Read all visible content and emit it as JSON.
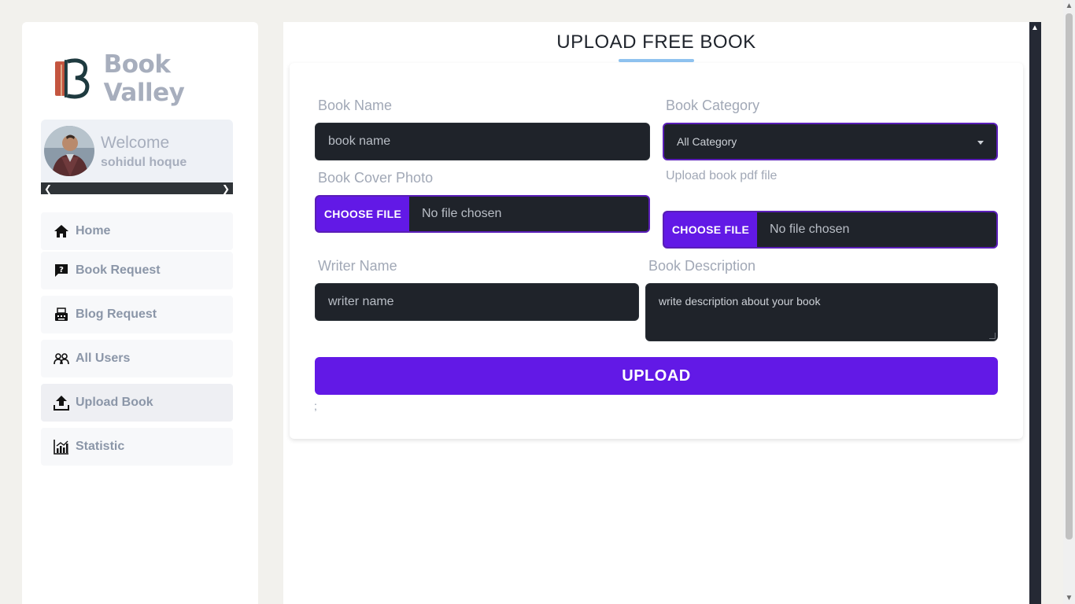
{
  "brand": {
    "name": "Book Valley",
    "logo_letter": "B"
  },
  "profile": {
    "greeting": "Welcome",
    "username": "sohidul hoque"
  },
  "sidebar": {
    "items": [
      {
        "label": "Home",
        "icon": "home-icon"
      },
      {
        "label": "Book Request",
        "icon": "question-chat-icon"
      },
      {
        "label": "Blog Request",
        "icon": "typewriter-icon"
      },
      {
        "label": "All Users",
        "icon": "users-icon"
      },
      {
        "label": "Upload Book",
        "icon": "upload-icon",
        "active": true
      },
      {
        "label": "Statistic",
        "icon": "chart-icon"
      }
    ]
  },
  "page": {
    "title": "UPLOAD FREE BOOK"
  },
  "form": {
    "book_name": {
      "label": "Book Name",
      "placeholder": "book name"
    },
    "book_category": {
      "label": "Book Category",
      "selected": "All Category"
    },
    "cover_photo": {
      "label": "Book Cover Photo",
      "button": "CHOOSE FILE",
      "status": "No file chosen"
    },
    "pdf_file": {
      "label": "Upload book pdf file",
      "button": "CHOOSE FILE",
      "status": "No file chosen"
    },
    "writer_name": {
      "label": "Writer Name",
      "placeholder": "writer name"
    },
    "description": {
      "label": "Book Description",
      "placeholder": "write description about your book"
    },
    "submit": "UPLOAD",
    "trailing_text": ";"
  },
  "colors": {
    "accent": "#6219e6",
    "input_bg": "#1f232a",
    "label": "#a1a8b6",
    "title_underline": "#8fc3f0"
  }
}
